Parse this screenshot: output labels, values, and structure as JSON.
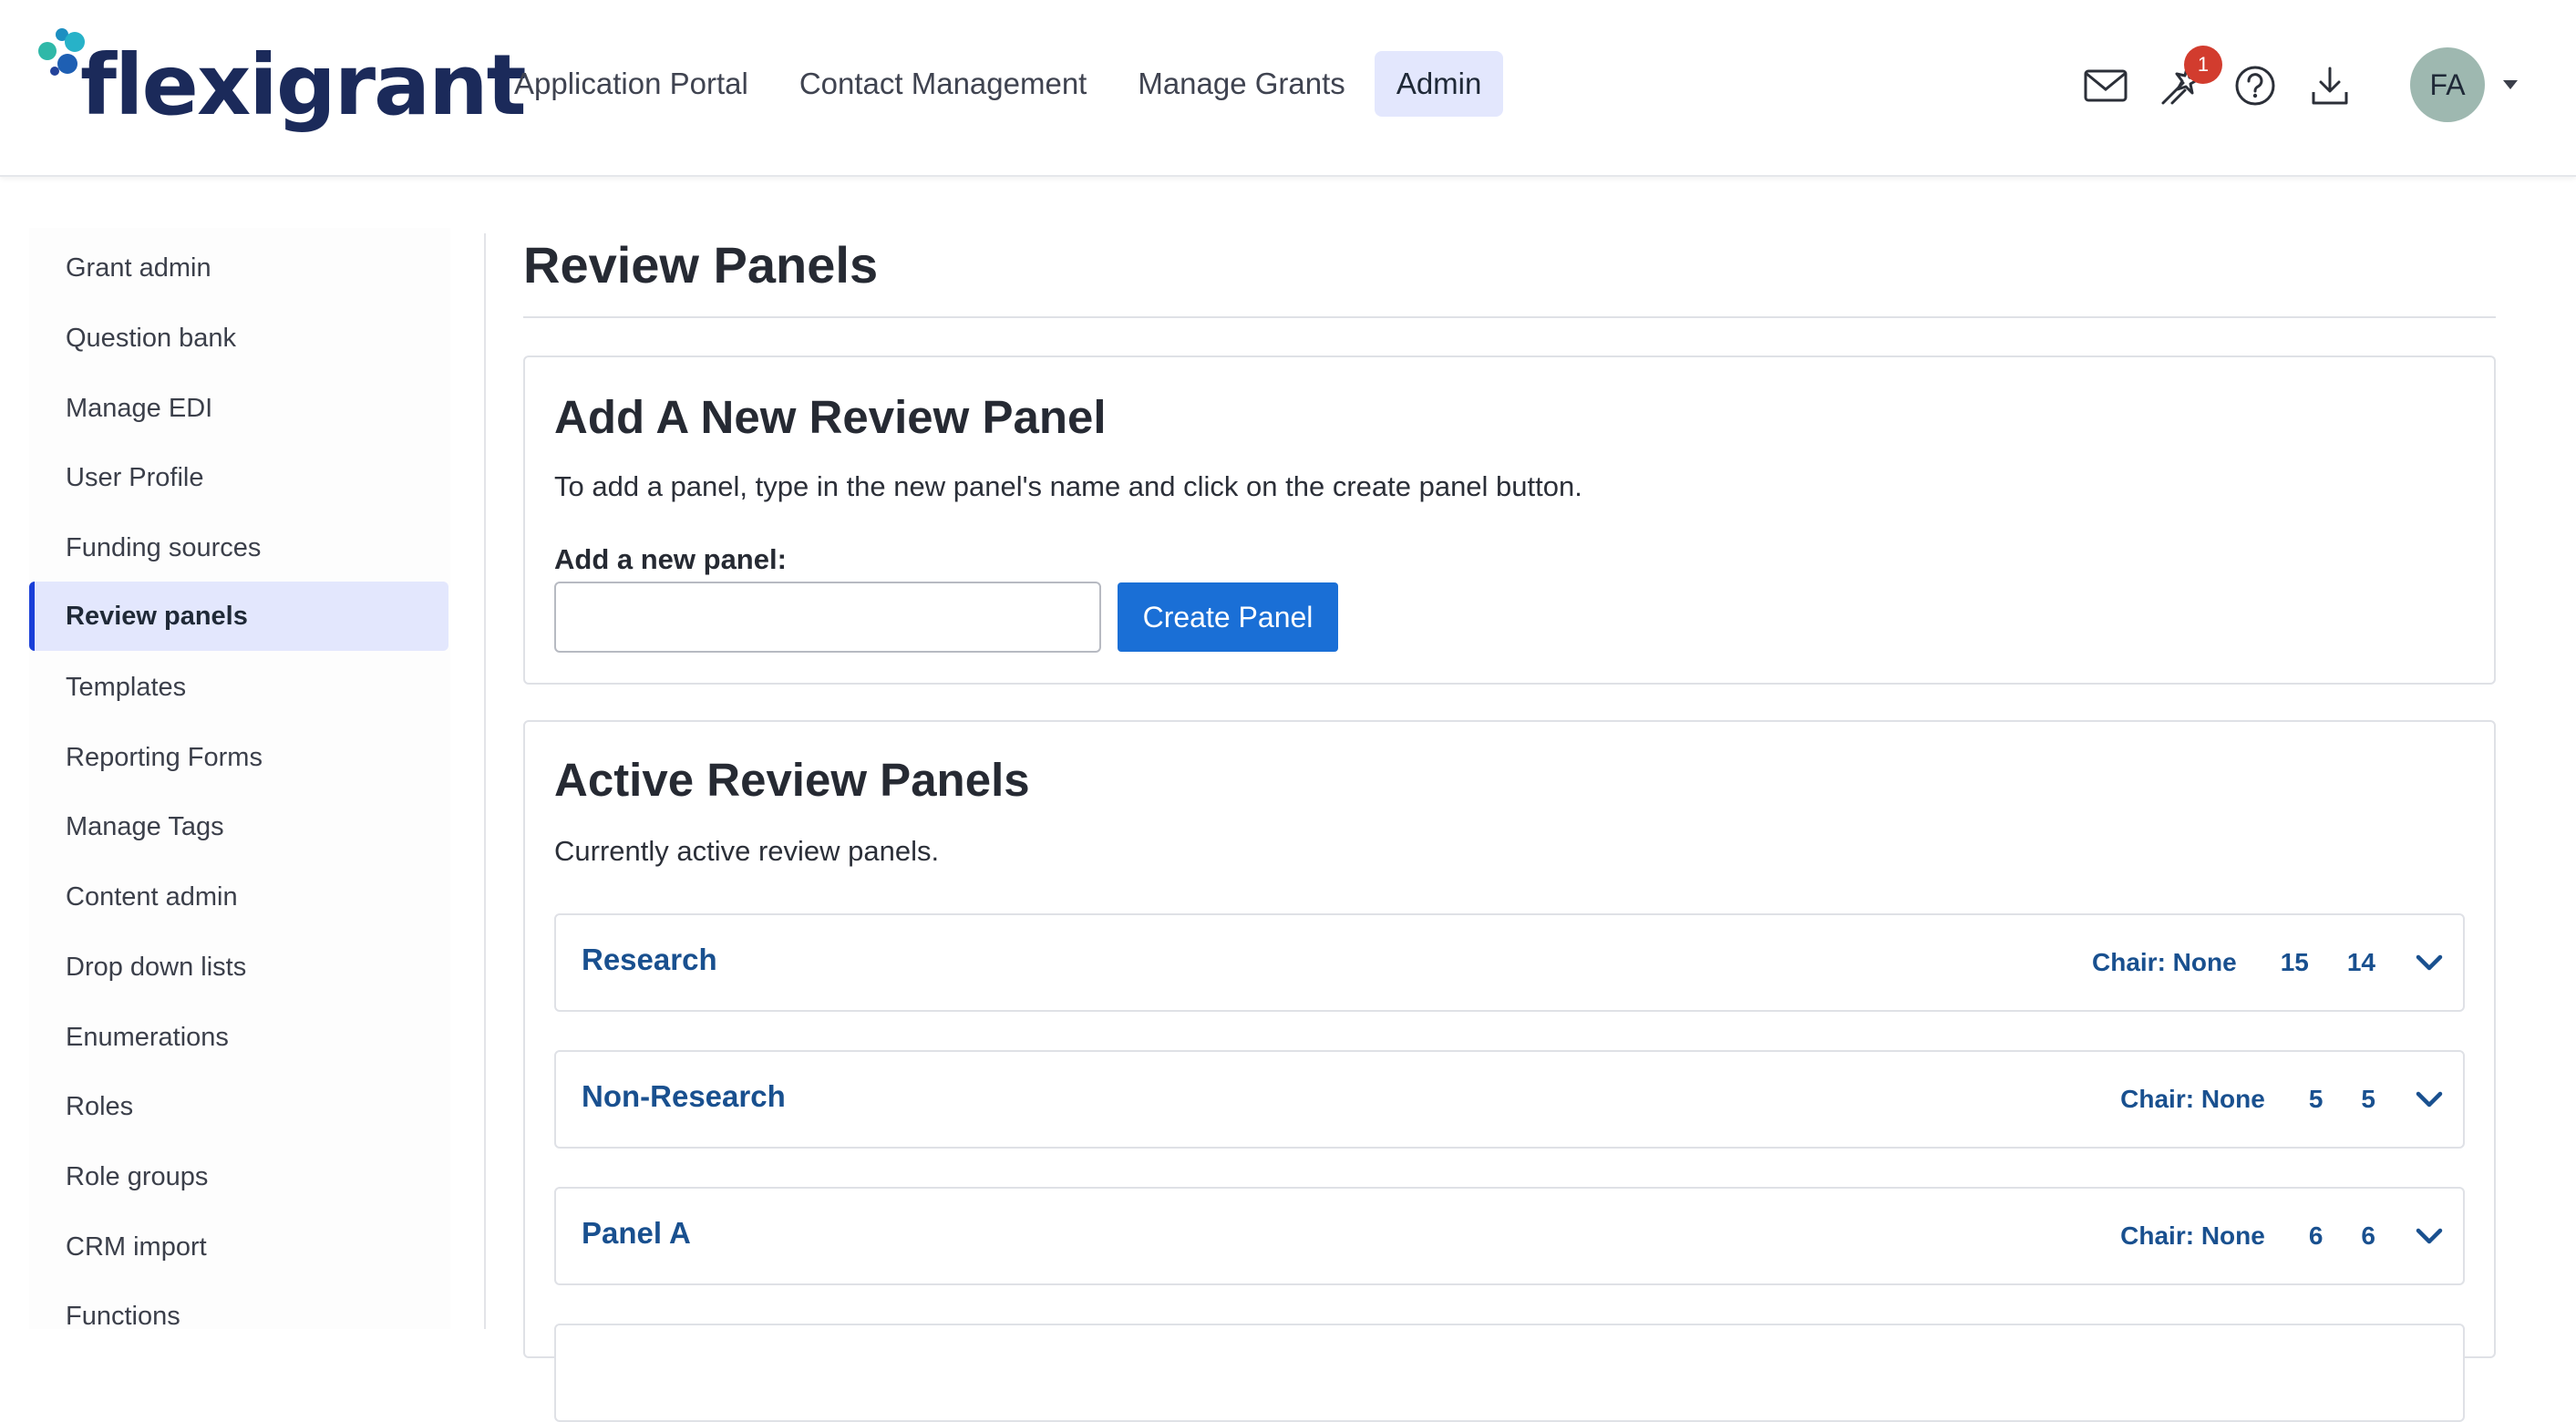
{
  "brand": {
    "name": "flexigrant"
  },
  "colors": {
    "accent": "#1a6fd6",
    "active_bg": "#e3e7fd",
    "link": "#19508f",
    "badge": "#d23c2e"
  },
  "nav": {
    "items": [
      {
        "label": "Application Portal"
      },
      {
        "label": "Contact Management"
      },
      {
        "label": "Manage Grants"
      },
      {
        "label": "Admin",
        "active": true
      }
    ]
  },
  "header_icons": {
    "mail": "mail-icon",
    "magic": "magic-wand-icon",
    "help": "help-icon",
    "download": "download-icon",
    "notification_count": "1"
  },
  "user": {
    "initials": "FA"
  },
  "sidebar": {
    "items": [
      {
        "label": "Grant admin"
      },
      {
        "label": "Question bank"
      },
      {
        "label": "Manage EDI"
      },
      {
        "label": "User Profile"
      },
      {
        "label": "Funding sources"
      },
      {
        "label": "Review panels",
        "active": true
      },
      {
        "label": "Templates"
      },
      {
        "label": "Reporting Forms"
      },
      {
        "label": "Manage Tags"
      },
      {
        "label": "Content admin"
      },
      {
        "label": "Drop down lists"
      },
      {
        "label": "Enumerations"
      },
      {
        "label": "Roles"
      },
      {
        "label": "Role groups"
      },
      {
        "label": "CRM import"
      },
      {
        "label": "Functions"
      }
    ]
  },
  "main": {
    "title": "Review Panels",
    "add_panel": {
      "title": "Add A New Review Panel",
      "description": "To add a panel, type in the new panel's name and click on the create panel button.",
      "field_label": "Add a new panel:",
      "input_value": "",
      "button_label": "Create Panel"
    },
    "active_panels": {
      "title": "Active Review Panels",
      "description": "Currently active review panels.",
      "panels": [
        {
          "name": "Research",
          "chair": "Chair: None",
          "count_a": "15",
          "count_b": "14"
        },
        {
          "name": "Non-Research",
          "chair": "Chair: None",
          "count_a": "5",
          "count_b": "5"
        },
        {
          "name": "Panel A",
          "chair": "Chair: None",
          "count_a": "6",
          "count_b": "6"
        }
      ]
    }
  }
}
